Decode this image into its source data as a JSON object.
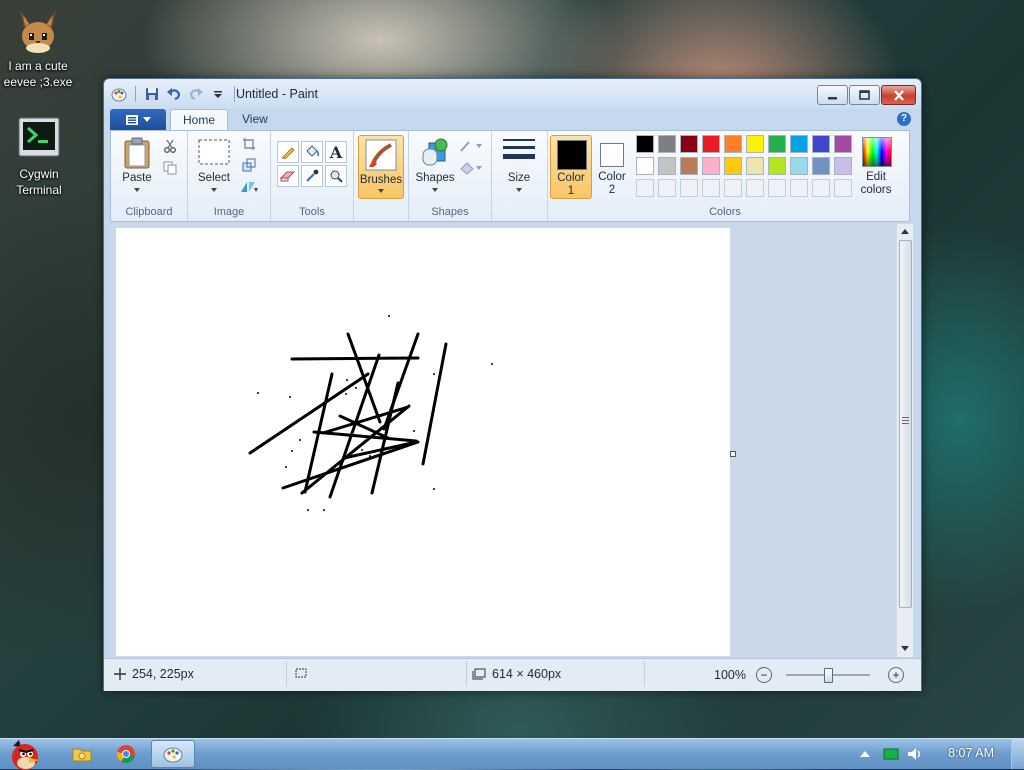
{
  "desktop": {
    "icons": [
      {
        "label": "I am a cute eevee ;3.exe",
        "icon": "eevee-icon"
      },
      {
        "label": "Cygwin Terminal",
        "icon": "terminal-icon"
      }
    ]
  },
  "window": {
    "title": "Untitled - Paint",
    "tabs": [
      "Home",
      "View"
    ],
    "active_tab": "Home",
    "ribbon": {
      "clipboard": {
        "paste": "Paste",
        "group": "Clipboard"
      },
      "image": {
        "select": "Select",
        "group": "Image"
      },
      "tools": {
        "group": "Tools",
        "text_tool": "A"
      },
      "brushes": {
        "label": "Brushes"
      },
      "shapes": {
        "label": "Shapes",
        "group": "Shapes"
      },
      "size": {
        "label": "Size"
      },
      "colors": {
        "color1_line1": "Color",
        "color1_line2": "1",
        "color2_line1": "Color",
        "color2_line2": "2",
        "edit_line1": "Edit",
        "edit_line2": "colors",
        "group": "Colors",
        "color1": "#000000",
        "color2": "#ffffff",
        "palette_row1": [
          "#000000",
          "#7f7f7f",
          "#880015",
          "#ed1c24",
          "#ff7f27",
          "#fff200",
          "#22b14c",
          "#00a2e8",
          "#3f48cc",
          "#a349a4"
        ],
        "palette_row2": [
          "#ffffff",
          "#c3c3c3",
          "#b97a57",
          "#ffaec9",
          "#ffc90e",
          "#efe4b0",
          "#b5e61d",
          "#99d9ea",
          "#7092be",
          "#c8bfe7"
        ]
      }
    },
    "status": {
      "cursor_pos": "254, 225px",
      "canvas_size": "614 × 460px",
      "zoom": "100%"
    }
  },
  "taskbar": {
    "clock": "8:07 AM",
    "pinned": [
      "angry-birds-icon",
      "folder-icon",
      "chrome-icon",
      "paint-icon"
    ]
  }
}
